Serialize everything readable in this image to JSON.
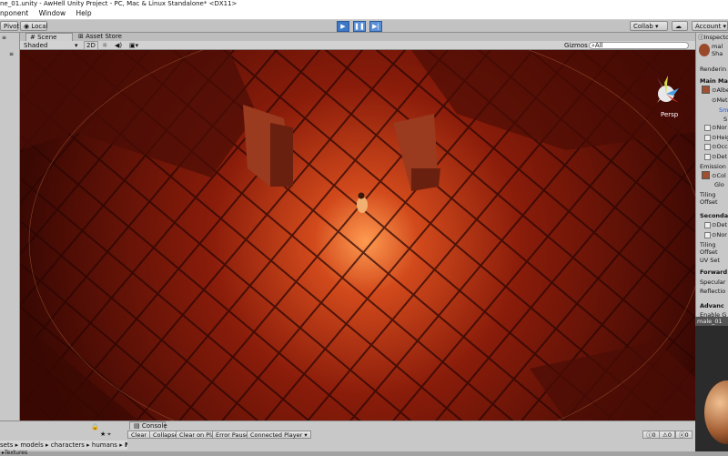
{
  "window": {
    "title": "ne_01.unity - AwHell Unity Project - PC, Mac & Linux Standalone* <DX11>"
  },
  "menu": [
    "nponent",
    "Window",
    "Help"
  ],
  "toolbar": {
    "pivot": "Pivot",
    "local": "Local",
    "collab": "Collab ▾",
    "account": "Account ▾"
  },
  "scene": {
    "tab_scene": "Scene",
    "tab_asset_store": "Asset Store",
    "shading_mode": "Shaded",
    "mode_2d": "2D",
    "gizmos": "Gizmos ▾",
    "search_placeholder": "All",
    "persp": "Persp"
  },
  "inspector": {
    "tab": "Inspecto",
    "material_name": "mal",
    "shader": "Sha",
    "rendering": "Renderin",
    "main_maps": "Main Ma",
    "albedo": "Albe",
    "metallic": "Met",
    "smoothness": "Sm",
    "smooth_s": "S",
    "normal": "Nor",
    "height": "Heig",
    "occlusion": "Occ",
    "detail": "Det",
    "emission": "Emission",
    "color": "Col",
    "global": "Glo",
    "tiling": "Tiling",
    "offset": "Offset",
    "secondary": "Seconda",
    "sec_detail": "Det",
    "sec_normal": "Nor",
    "sec_tiling": "Tiling",
    "sec_offset": "Offset",
    "uv_set": "UV Set",
    "forward": "Forward",
    "specular": "Specular",
    "reflections": "Reflectio",
    "advanced": "Advanc",
    "enable": "Enable G",
    "preview_name": "male_01"
  },
  "project": {
    "breadcrumb": [
      "sets",
      "models",
      "characters",
      "humans",
      "Ma"
    ],
    "bottom_label": "Textures"
  },
  "console": {
    "tab": "Console",
    "buttons": [
      "Clear",
      "Collapse",
      "Clear on Play",
      "Error Pause",
      "Connected Player ▾"
    ],
    "counts": [
      "0",
      "0",
      "0"
    ]
  },
  "colors": {
    "play_blue": "#3d78c8",
    "floor": "#7a1a0a",
    "light": "#ff8a40"
  }
}
